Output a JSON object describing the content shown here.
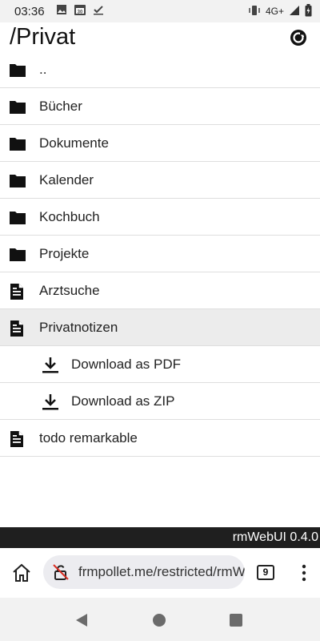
{
  "status_bar": {
    "time": "03:36",
    "network": "4G+",
    "icons": [
      "image-icon",
      "calendar-icon",
      "check-icon",
      "vibrate-icon",
      "signal-icon",
      "battery-icon"
    ],
    "calendar_day": "30"
  },
  "header": {
    "title": "/Privat",
    "refresh_icon": "refresh-icon"
  },
  "items": [
    {
      "label": "..",
      "type": "folder"
    },
    {
      "label": "Bücher",
      "type": "folder"
    },
    {
      "label": "Dokumente",
      "type": "folder"
    },
    {
      "label": "Kalender",
      "type": "folder"
    },
    {
      "label": "Kochbuch",
      "type": "folder"
    },
    {
      "label": "Projekte",
      "type": "folder"
    },
    {
      "label": "Arztsuche",
      "type": "document"
    },
    {
      "label": "Privatnotizen",
      "type": "document",
      "selected": true
    },
    {
      "label": "Download as PDF",
      "type": "download"
    },
    {
      "label": "Download as ZIP",
      "type": "download"
    },
    {
      "label": "todo remarkable",
      "type": "document"
    }
  ],
  "footer": {
    "version_text": "rmWebUI 0.4.0"
  },
  "browser": {
    "url": "frmpollet.me/restricted/rmWebUI",
    "tab_count": "9"
  },
  "colors": {
    "footer_bg": "#1f1f1f",
    "selected_bg": "#ececec",
    "url_bg": "#ececf0"
  }
}
